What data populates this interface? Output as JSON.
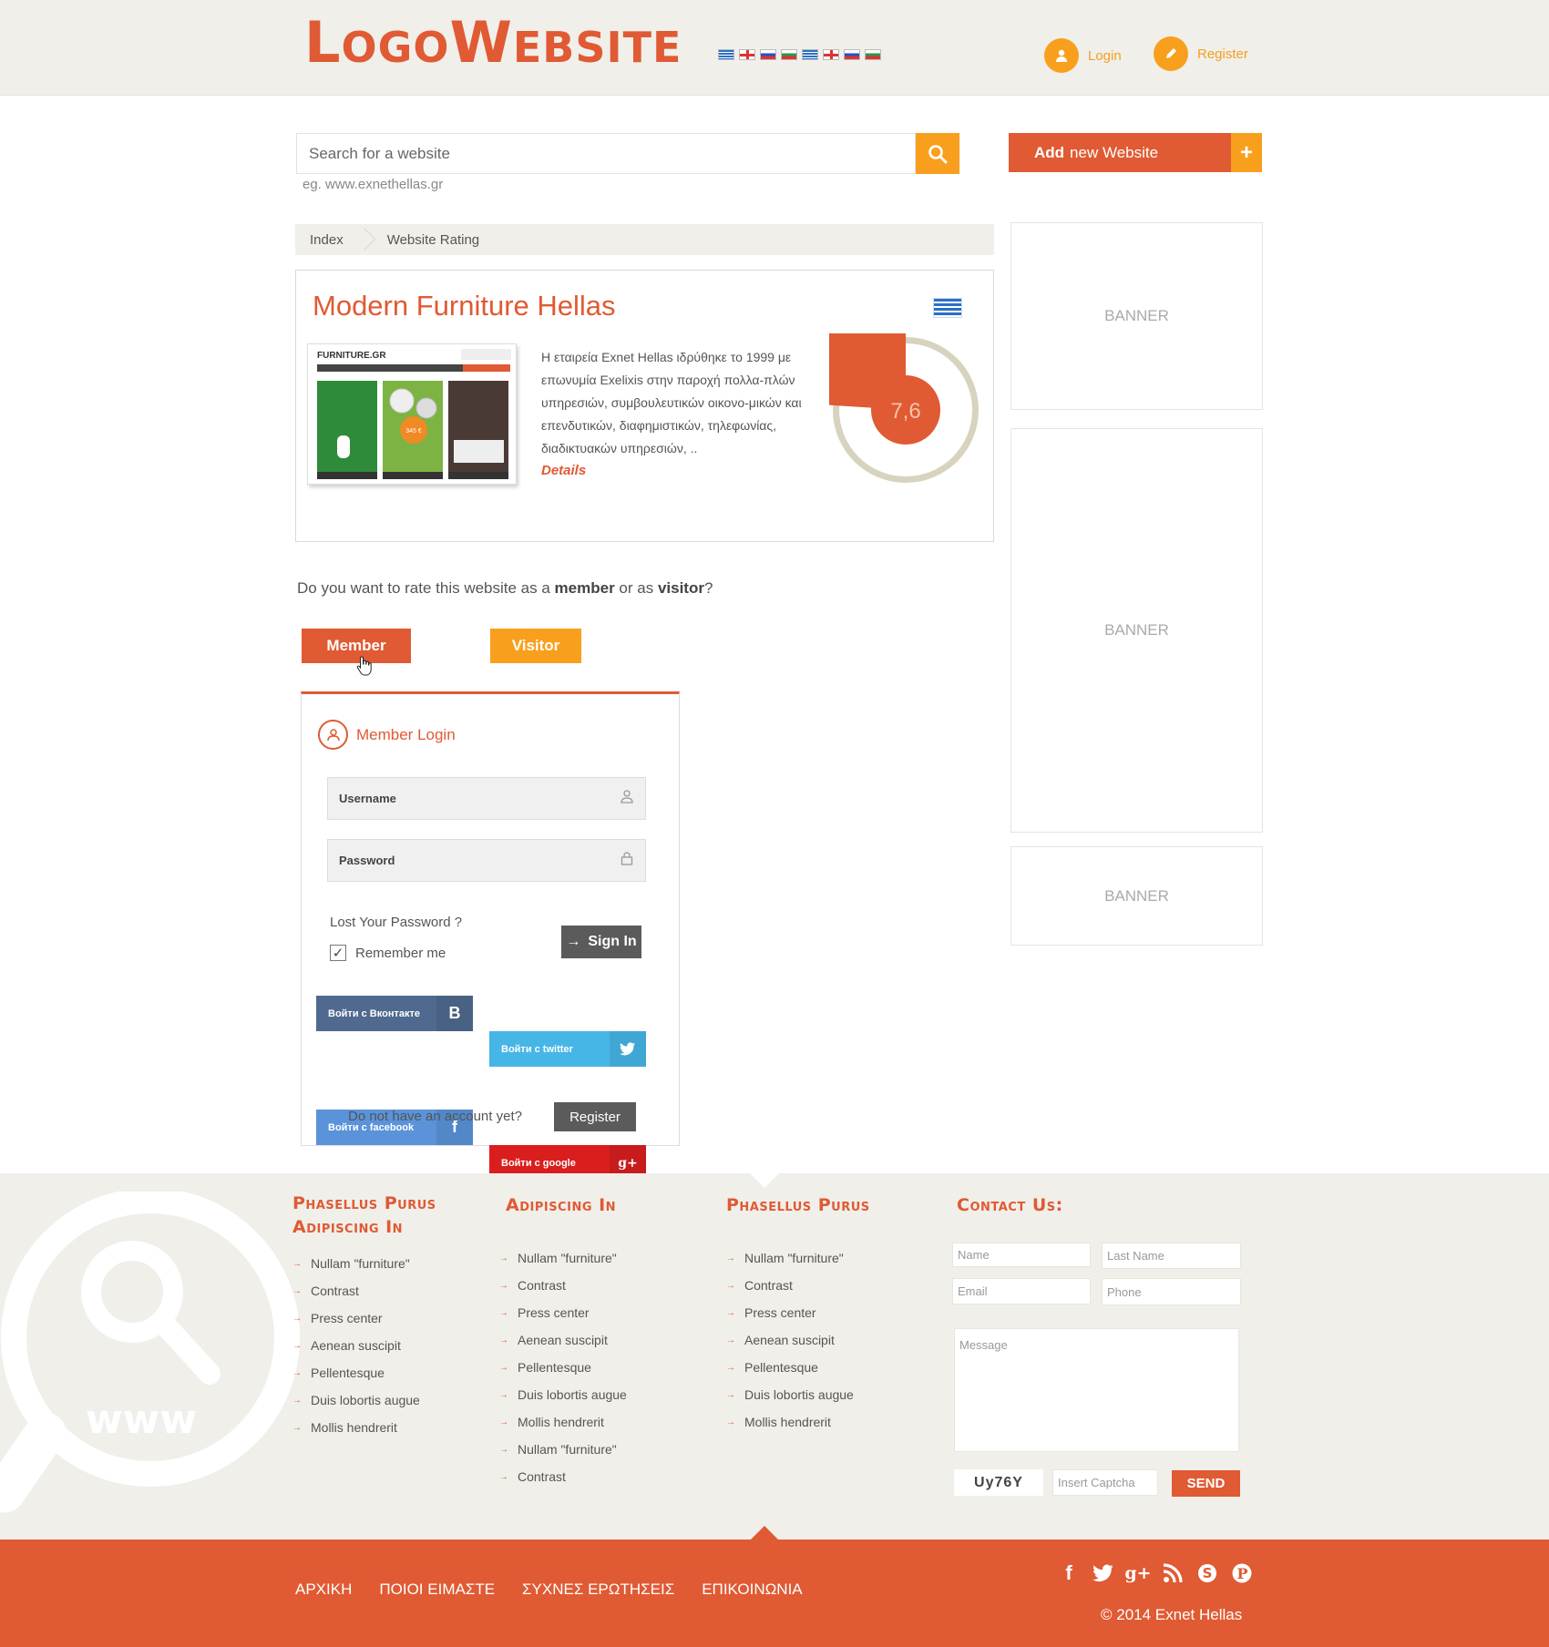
{
  "brand": {
    "logo_text_1": "Logo",
    "logo_text_2": "Website",
    "accent": "#e05a33",
    "secondary": "#f8a01d"
  },
  "header": {
    "login_label": "Login",
    "register_label": "Register"
  },
  "search": {
    "placeholder": "Search for a website",
    "hint": "eg. www.exnethellas.gr",
    "add_label_bold": "Add",
    "add_label_rest": "new Website"
  },
  "breadcrumb": [
    "Index",
    "Website Rating"
  ],
  "site": {
    "title": "Modern Furniture Hellas",
    "description": "Η εταιρεία Exnet Hellas ιδρύθηκε το 1999 με επωνυμία Exelixis στην  παροχή πολλα-πλών υπηρεσιών, συμβουλευτικών οικονο-μικών και επενδυτικών, διαφημιστικών, τηλεφωνίας, διαδικτυακών υπηρεσιών, ..",
    "details_label": "Details",
    "thumb_brand": "FURNITURE.GR",
    "thumb_price": "345 €",
    "rating_display": "7,6",
    "rating_value": 7.6,
    "rating_max": 10
  },
  "rate": {
    "question_1": "Do you want to rate this website as a ",
    "member_word": "member",
    "question_2": " or as ",
    "visitor_word": "visitor",
    "question_3": "?",
    "member_label": "Member",
    "visitor_label": "Visitor"
  },
  "login": {
    "title": "Member Login",
    "username_placeholder": "Username",
    "password_placeholder": "Password",
    "lost_password": "Lost Your Password ?",
    "remember": "Remember me",
    "signin": "Sign In",
    "vk": "Войти с Вконтакте",
    "twitter": "Войти с twitter",
    "facebook": "Войти с facebook",
    "google": "Войти с google",
    "no_account": "Do not have an account yet?",
    "register": "Register"
  },
  "banners": [
    "BANNER",
    "BANNER",
    "BANNER"
  ],
  "footer": {
    "col1": {
      "title": "Phasellus Purus Adipiscing In",
      "items": [
        "Nullam \"furniture\"",
        "Contrast",
        "Press center",
        "Aenean suscipit",
        "Pellentesque",
        "Duis lobortis augue",
        "Mollis hendrerit"
      ]
    },
    "col2": {
      "title": "Adipiscing In",
      "items": [
        "Nullam \"furniture\"",
        "Contrast",
        "Press center",
        "Aenean suscipit",
        "Pellentesque",
        "Duis lobortis augue",
        "Mollis hendrerit",
        "Nullam \"furniture\"",
        "Contrast"
      ]
    },
    "col3": {
      "title": "Phasellus Purus",
      "items": [
        "Nullam \"furniture\"",
        "Contrast",
        "Press center",
        "Aenean suscipit",
        "Pellentesque",
        "Duis lobortis augue",
        "Mollis hendrerit"
      ]
    },
    "contact": {
      "title": "Contact Us:",
      "name": "Name",
      "last_name": "Last Name",
      "email": "Email",
      "phone": "Phone",
      "message": "Message",
      "captcha_code": "Uy76Y",
      "captcha_placeholder": "Insert Captcha",
      "send": "SEND"
    },
    "watermark_text": "www",
    "nav": [
      "ΑΡΧΙΚΗ",
      "ΠΟΙΟΙ ΕΙΜΑΣΤΕ",
      "ΣΥΧΝΕΣ ΕΡΩΤΗΣΕΙΣ",
      "ΕΠΙΚΟΙΝΩΝΙΑ"
    ],
    "copyright": "© 2014 Exnet Hellas"
  }
}
